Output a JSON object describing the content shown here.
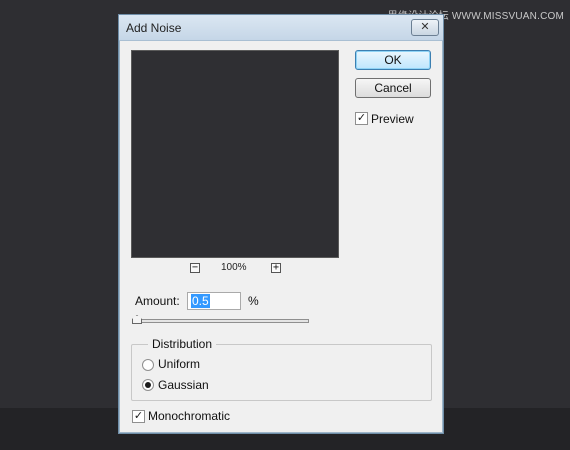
{
  "watermark": "思缘设计论坛 WWW.MISSVUAN.COM",
  "dialog": {
    "title": "Add Noise",
    "close_glyph": "✕",
    "zoom": {
      "minus": "−",
      "level": "100%",
      "plus": "+"
    },
    "buttons": {
      "ok": "OK",
      "cancel": "Cancel"
    },
    "preview": {
      "label": "Preview",
      "checked": true,
      "check_glyph": "✓"
    },
    "amount": {
      "label": "Amount:",
      "value": "0.5",
      "unit": "%",
      "slider_fraction": 0.0
    },
    "distribution": {
      "label": "Distribution",
      "options": [
        {
          "label": "Uniform",
          "selected": false
        },
        {
          "label": "Gaussian",
          "selected": true
        }
      ]
    },
    "monochromatic": {
      "label": "Monochromatic",
      "checked": true,
      "check_glyph": "✓"
    }
  }
}
